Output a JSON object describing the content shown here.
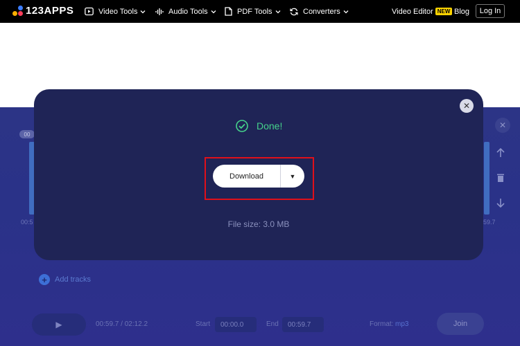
{
  "nav": {
    "brand": "123APPS",
    "items": [
      {
        "label": "Video Tools",
        "icon": "play-square-icon"
      },
      {
        "label": "Audio Tools",
        "icon": "audio-wave-icon"
      },
      {
        "label": "PDF Tools",
        "icon": "document-icon"
      },
      {
        "label": "Converters",
        "icon": "refresh-icon"
      }
    ],
    "video_editor": "Video Editor",
    "new_badge": "NEW",
    "blog": "Blog",
    "login": "Log In"
  },
  "modal": {
    "status": "Done!",
    "download_label": "Download",
    "file_size": "File size: 3.0 MB",
    "colors": {
      "success": "#45d38b",
      "highlight": "#e0101a"
    }
  },
  "editor_bg": {
    "badge": "00",
    "time_left": "00:5",
    "time_right": "59.7",
    "add_tracks": "Add tracks",
    "playback_time": "00:59.7 / 02:12.2",
    "start_label": "Start",
    "start_value": "00:00.0",
    "end_label": "End",
    "end_value": "00:59.7",
    "format_label": "Format:",
    "format_value": "mp3",
    "join": "Join"
  }
}
